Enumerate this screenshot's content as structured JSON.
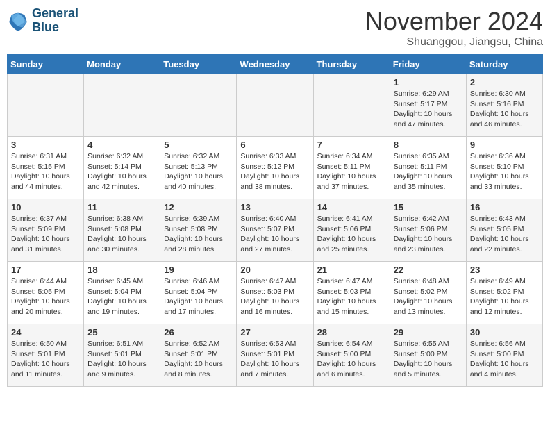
{
  "logo": {
    "line1": "General",
    "line2": "Blue"
  },
  "title": "November 2024",
  "location": "Shuanggou, Jiangsu, China",
  "weekdays": [
    "Sunday",
    "Monday",
    "Tuesday",
    "Wednesday",
    "Thursday",
    "Friday",
    "Saturday"
  ],
  "weeks": [
    [
      {
        "day": "",
        "content": ""
      },
      {
        "day": "",
        "content": ""
      },
      {
        "day": "",
        "content": ""
      },
      {
        "day": "",
        "content": ""
      },
      {
        "day": "",
        "content": ""
      },
      {
        "day": "1",
        "content": "Sunrise: 6:29 AM\nSunset: 5:17 PM\nDaylight: 10 hours and 47 minutes."
      },
      {
        "day": "2",
        "content": "Sunrise: 6:30 AM\nSunset: 5:16 PM\nDaylight: 10 hours and 46 minutes."
      }
    ],
    [
      {
        "day": "3",
        "content": "Sunrise: 6:31 AM\nSunset: 5:15 PM\nDaylight: 10 hours and 44 minutes."
      },
      {
        "day": "4",
        "content": "Sunrise: 6:32 AM\nSunset: 5:14 PM\nDaylight: 10 hours and 42 minutes."
      },
      {
        "day": "5",
        "content": "Sunrise: 6:32 AM\nSunset: 5:13 PM\nDaylight: 10 hours and 40 minutes."
      },
      {
        "day": "6",
        "content": "Sunrise: 6:33 AM\nSunset: 5:12 PM\nDaylight: 10 hours and 38 minutes."
      },
      {
        "day": "7",
        "content": "Sunrise: 6:34 AM\nSunset: 5:11 PM\nDaylight: 10 hours and 37 minutes."
      },
      {
        "day": "8",
        "content": "Sunrise: 6:35 AM\nSunset: 5:11 PM\nDaylight: 10 hours and 35 minutes."
      },
      {
        "day": "9",
        "content": "Sunrise: 6:36 AM\nSunset: 5:10 PM\nDaylight: 10 hours and 33 minutes."
      }
    ],
    [
      {
        "day": "10",
        "content": "Sunrise: 6:37 AM\nSunset: 5:09 PM\nDaylight: 10 hours and 31 minutes."
      },
      {
        "day": "11",
        "content": "Sunrise: 6:38 AM\nSunset: 5:08 PM\nDaylight: 10 hours and 30 minutes."
      },
      {
        "day": "12",
        "content": "Sunrise: 6:39 AM\nSunset: 5:08 PM\nDaylight: 10 hours and 28 minutes."
      },
      {
        "day": "13",
        "content": "Sunrise: 6:40 AM\nSunset: 5:07 PM\nDaylight: 10 hours and 27 minutes."
      },
      {
        "day": "14",
        "content": "Sunrise: 6:41 AM\nSunset: 5:06 PM\nDaylight: 10 hours and 25 minutes."
      },
      {
        "day": "15",
        "content": "Sunrise: 6:42 AM\nSunset: 5:06 PM\nDaylight: 10 hours and 23 minutes."
      },
      {
        "day": "16",
        "content": "Sunrise: 6:43 AM\nSunset: 5:05 PM\nDaylight: 10 hours and 22 minutes."
      }
    ],
    [
      {
        "day": "17",
        "content": "Sunrise: 6:44 AM\nSunset: 5:05 PM\nDaylight: 10 hours and 20 minutes."
      },
      {
        "day": "18",
        "content": "Sunrise: 6:45 AM\nSunset: 5:04 PM\nDaylight: 10 hours and 19 minutes."
      },
      {
        "day": "19",
        "content": "Sunrise: 6:46 AM\nSunset: 5:04 PM\nDaylight: 10 hours and 17 minutes."
      },
      {
        "day": "20",
        "content": "Sunrise: 6:47 AM\nSunset: 5:03 PM\nDaylight: 10 hours and 16 minutes."
      },
      {
        "day": "21",
        "content": "Sunrise: 6:47 AM\nSunset: 5:03 PM\nDaylight: 10 hours and 15 minutes."
      },
      {
        "day": "22",
        "content": "Sunrise: 6:48 AM\nSunset: 5:02 PM\nDaylight: 10 hours and 13 minutes."
      },
      {
        "day": "23",
        "content": "Sunrise: 6:49 AM\nSunset: 5:02 PM\nDaylight: 10 hours and 12 minutes."
      }
    ],
    [
      {
        "day": "24",
        "content": "Sunrise: 6:50 AM\nSunset: 5:01 PM\nDaylight: 10 hours and 11 minutes."
      },
      {
        "day": "25",
        "content": "Sunrise: 6:51 AM\nSunset: 5:01 PM\nDaylight: 10 hours and 9 minutes."
      },
      {
        "day": "26",
        "content": "Sunrise: 6:52 AM\nSunset: 5:01 PM\nDaylight: 10 hours and 8 minutes."
      },
      {
        "day": "27",
        "content": "Sunrise: 6:53 AM\nSunset: 5:01 PM\nDaylight: 10 hours and 7 minutes."
      },
      {
        "day": "28",
        "content": "Sunrise: 6:54 AM\nSunset: 5:00 PM\nDaylight: 10 hours and 6 minutes."
      },
      {
        "day": "29",
        "content": "Sunrise: 6:55 AM\nSunset: 5:00 PM\nDaylight: 10 hours and 5 minutes."
      },
      {
        "day": "30",
        "content": "Sunrise: 6:56 AM\nSunset: 5:00 PM\nDaylight: 10 hours and 4 minutes."
      }
    ]
  ]
}
